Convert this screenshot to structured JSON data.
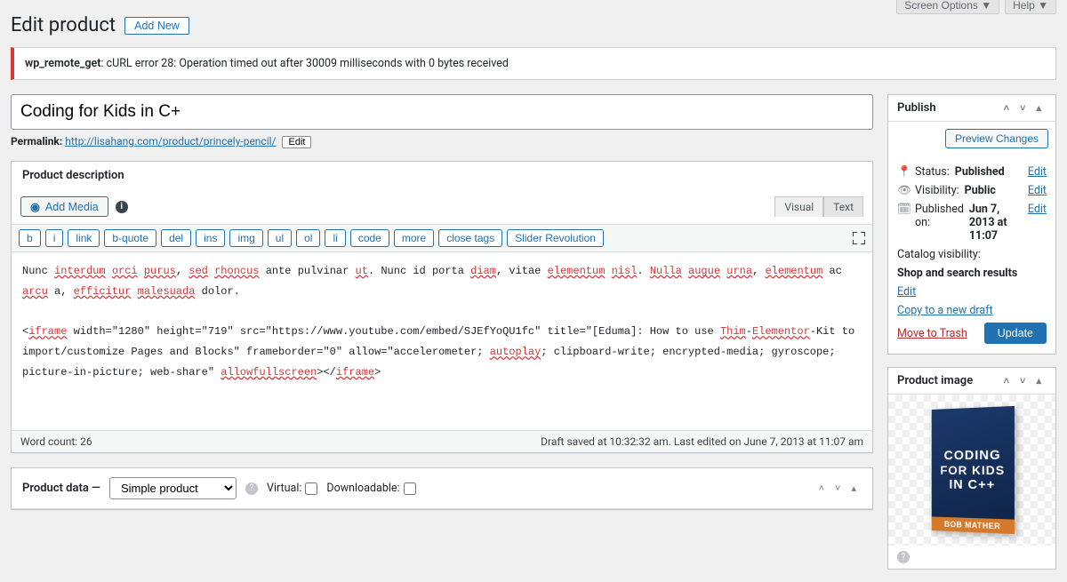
{
  "top": {
    "screen_options": "Screen Options ▼",
    "help": "Help ▼"
  },
  "header": {
    "title": "Edit product",
    "add_new": "Add New"
  },
  "notice": {
    "prefix": "wp_remote_get",
    "msg": ": cURL error 28: Operation timed out after 30009 milliseconds with 0 bytes received"
  },
  "title_field": {
    "value": "Coding for Kids in C+"
  },
  "permalink": {
    "label": "Permalink:",
    "base": "http://lisahang.com/product/",
    "slug": "princely-pencil/",
    "edit": "Edit"
  },
  "desc_box": {
    "heading": "Product description",
    "add_media": "Add Media",
    "tabs": {
      "visual": "Visual",
      "text": "Text"
    },
    "toolbar": [
      "b",
      "i",
      "link",
      "b-quote",
      "del",
      "ins",
      "img",
      "ul",
      "ol",
      "li",
      "code",
      "more",
      "close tags",
      "Slider Revolution"
    ]
  },
  "editor": {
    "p1_parts": [
      {
        "t": "Nunc "
      },
      {
        "t": "interdum",
        "u": 1
      },
      {
        "t": " "
      },
      {
        "t": "orci",
        "u": 1
      },
      {
        "t": " "
      },
      {
        "t": "purus",
        "u": 1
      },
      {
        "t": ", "
      },
      {
        "t": "sed",
        "u": 1
      },
      {
        "t": " "
      },
      {
        "t": "rhoncus",
        "u": 1
      },
      {
        "t": " ante pulvinar "
      },
      {
        "t": "ut",
        "u": 1
      },
      {
        "t": ". Nunc id porta "
      },
      {
        "t": "diam",
        "u": 1
      },
      {
        "t": ", vitae "
      },
      {
        "t": "elementum",
        "u": 1
      },
      {
        "t": " "
      },
      {
        "t": "nisl",
        "u": 1
      },
      {
        "t": ". "
      },
      {
        "t": "Nulla",
        "u": 1
      },
      {
        "t": " "
      },
      {
        "t": "augue",
        "u": 1
      },
      {
        "t": " "
      },
      {
        "t": "urna",
        "u": 1
      },
      {
        "t": ", "
      },
      {
        "t": "elementum",
        "u": 1
      },
      {
        "t": " ac "
      },
      {
        "t": "arcu",
        "u": 1
      },
      {
        "t": " a, "
      },
      {
        "t": "efficitur",
        "u": 1
      },
      {
        "t": " "
      },
      {
        "t": "malesuada",
        "u": 1
      },
      {
        "t": " dolor."
      }
    ],
    "p2_parts": [
      {
        "t": "<"
      },
      {
        "t": "iframe",
        "u": 1
      },
      {
        "t": " width=\"1280\" height=\"719\" src=\"https://www.youtube.com/embed/SJEfYoQU1fc\" title=\"[Eduma]: How to use "
      },
      {
        "t": "Thim",
        "u": 1
      },
      {
        "t": "-"
      },
      {
        "t": "Elementor",
        "u": 1
      },
      {
        "t": "-Kit to import/customize Pages and Blocks\" frameborder=\"0\" allow=\"accelerometer; "
      },
      {
        "t": "autoplay",
        "u": 1
      },
      {
        "t": "; clipboard-write; encrypted-media; gyroscope; picture-in-picture; web-share\" "
      },
      {
        "t": "allowfullscreen",
        "u": 1
      },
      {
        "t": "></"
      },
      {
        "t": "iframe",
        "u": 1
      },
      {
        "t": ">"
      }
    ]
  },
  "status_bar": {
    "left": "Word count: 26",
    "right": "Draft saved at 10:32:32 am. Last edited on June 7, 2013 at 11:07 am"
  },
  "product_data": {
    "label": "Product data —",
    "select": "Simple product",
    "virtual": "Virtual:",
    "downloadable": "Downloadable:"
  },
  "publish": {
    "heading": "Publish",
    "preview": "Preview Changes",
    "status_label": "Status:",
    "status_val": "Published",
    "edit": "Edit",
    "vis_label": "Visibility:",
    "vis_val": "Public",
    "pub_label": "Published on:",
    "pub_val": "Jun 7, 2013 at 11:07",
    "cat_label": "Catalog visibility:",
    "cat_val": "Shop and search results",
    "copy": "Copy to a new draft",
    "trash": "Move to Trash",
    "update": "Update"
  },
  "image_box": {
    "heading": "Product image",
    "book_line1": "CODING",
    "book_line2": "FOR KIDS",
    "book_line3": "IN C++",
    "author": "BOB MATHER"
  }
}
